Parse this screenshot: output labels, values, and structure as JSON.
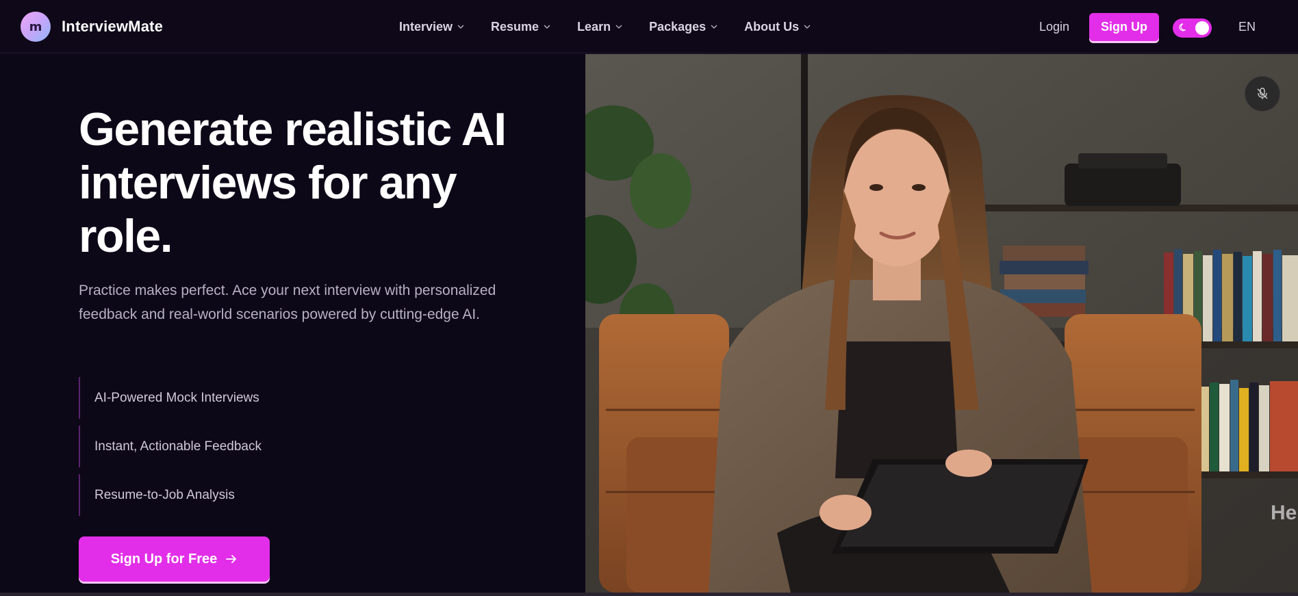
{
  "brand": {
    "logo_letter": "m",
    "name": "InterviewMate"
  },
  "nav": {
    "menu": [
      {
        "label": "Interview"
      },
      {
        "label": "Resume"
      },
      {
        "label": "Learn"
      },
      {
        "label": "Packages"
      },
      {
        "label": "About Us"
      }
    ],
    "login_label": "Login",
    "signup_label": "Sign Up",
    "theme_toggle": "dark",
    "language": "EN"
  },
  "hero": {
    "title": "Generate realistic AI interviews for any role.",
    "subtitle": "Practice makes perfect. Ace your next interview with personalized feedback and real-world scenarios powered by cutting-edge AI.",
    "features": [
      "AI-Powered Mock Interviews",
      "Instant, Actionable Feedback",
      "Resume-to-Job Analysis"
    ],
    "cta_label": "Sign Up for Free"
  },
  "video": {
    "watermark": "He"
  },
  "colors": {
    "accent": "#e22ee8",
    "background": "#0d0817"
  }
}
